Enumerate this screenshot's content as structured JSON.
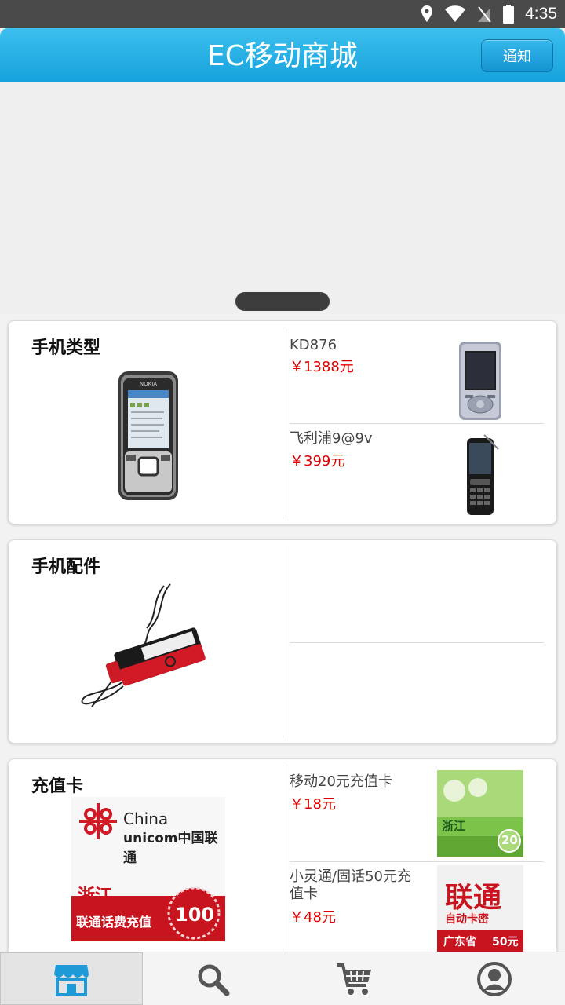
{
  "status_bar": {
    "time": "4:35"
  },
  "header": {
    "title": "EC移动商城",
    "notify_label": "通知"
  },
  "categories": [
    {
      "title": "手机类型",
      "items": [
        {
          "name": "KD876",
          "price": "￥1388元"
        },
        {
          "name": "飞利浦9@9v",
          "price": "￥399元"
        }
      ]
    },
    {
      "title": "手机配件",
      "items": []
    },
    {
      "title": "充值卡",
      "items": [
        {
          "name": "移动20元充值卡",
          "price": "￥18元"
        },
        {
          "name": "小灵通/固话50元充值卡",
          "price": "￥48元"
        }
      ],
      "image_text": {
        "china": "China",
        "unicom": "unicom中国联通",
        "province": "浙江",
        "recharge": "联通话费充值",
        "value": "100"
      },
      "thumb_text": {
        "mobile_province": "浙江",
        "mobile_value": "20",
        "unicom_word": "联通",
        "unicom_sub": "自动卡密",
        "unicom_province": "广东省",
        "unicom_value": "50元"
      }
    }
  ],
  "tabs": [
    {
      "icon": "shop-icon",
      "active": true
    },
    {
      "icon": "search-icon",
      "active": false
    },
    {
      "icon": "cart-icon",
      "active": false
    },
    {
      "icon": "user-icon",
      "active": false
    }
  ],
  "colors": {
    "header": "#1fa8e0",
    "price": "#e00000",
    "active_tab": "#1e9bd6"
  }
}
